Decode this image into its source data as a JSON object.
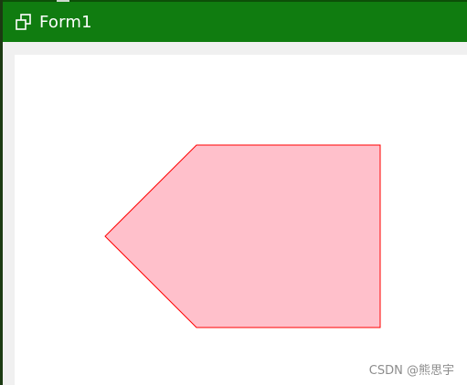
{
  "window": {
    "title": "Form1",
    "titlebar_color": "#107c10",
    "icon": "restore-window-icon"
  },
  "shape": {
    "type": "pentagon-arrow",
    "fill": "#ffc0cb",
    "stroke": "#ff0000"
  },
  "watermark": {
    "text": "CSDN @熊思宇"
  }
}
